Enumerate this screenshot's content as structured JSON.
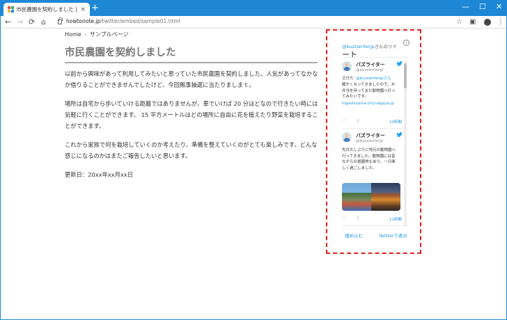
{
  "browser": {
    "tab_title": "市民農園を契約しました | バズブログ",
    "tab_close": "×",
    "new_tab": "+",
    "url_host": "howtonote.jp",
    "url_path": "/twitter/embed/sample01.html",
    "window_controls": [
      "—",
      "☐",
      "✕"
    ]
  },
  "page": {
    "breadcrumb_home": "Home",
    "breadcrumb_sep": "›",
    "breadcrumb_current": "サンプルページ",
    "title": "市民農園を契約しました",
    "paragraphs": [
      "以前から興味があって利用してみたいと思っていた市民農園を契約しました。人気があってなかなか借りることができませんでしたけど、今回無事抽選に当たりましまｔ。",
      "場所は自宅から歩いていける距離ではありませんが、車でいけば 20 分ほどなので行きたい時には気軽に行くことができます。 15 平方メートルほどの場所に自由に花を植えたり野菜を栽培することができます。",
      "これから家族で何を栽培していくのか考えたり、準備を整えていくのがとても楽しみです。どんな感じになるのかはまたご報告したいと思います。"
    ],
    "updated": "更新日：20xx年xx月xx日"
  },
  "timeline": {
    "header_handle": "@buzzwriterjp",
    "header_suffix": "さんのツイ",
    "header_tweet_word": "ート",
    "info": "i",
    "tweets": [
      {
        "name": "バズライター",
        "handle": "@buzzwriterjp",
        "reply_prefix": "返信先: ",
        "reply_mention": "@buzzwriterjpさん",
        "text": "暖かくなってきましたので、お弁当を持ってまた動物園へ行ってみたいです。",
        "link": "higashiyama.city.nagoya.jp",
        "time": "10時間"
      },
      {
        "name": "バズライター",
        "handle": "@buzzwriterjp",
        "text": "先日久しぶりに地元の動物園へ行ってきました。動物園には昔ながらの遊園地もあり、一日楽しく過ごしました。",
        "time": "11時間"
      }
    ],
    "embed_label": "埋め込む",
    "view_label": "Twitterで表示"
  },
  "colors": {
    "chrome_blue": "#1e88d6",
    "twitter_blue": "#1b95e0",
    "highlight_red": "#e02020"
  }
}
